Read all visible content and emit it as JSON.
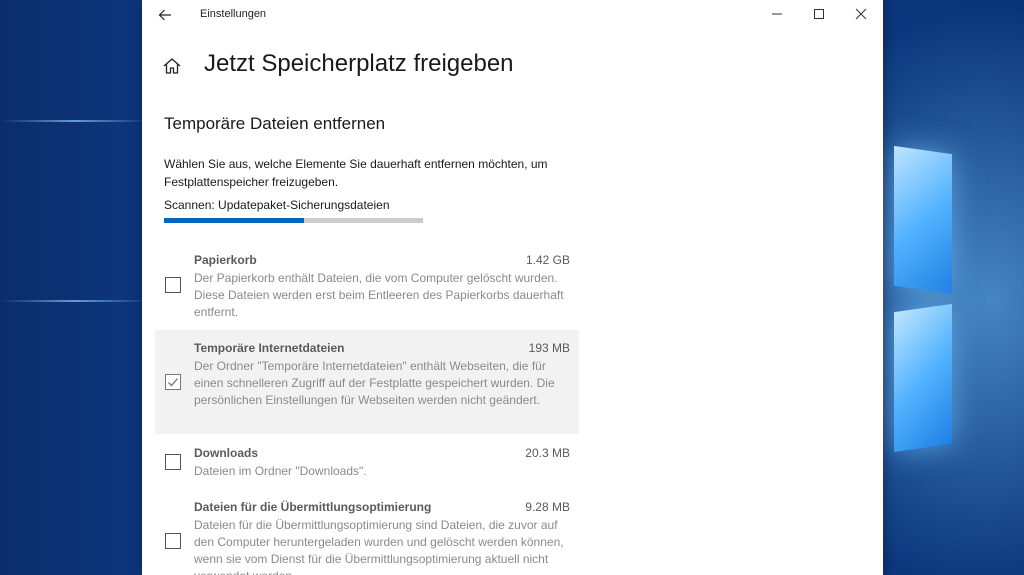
{
  "window": {
    "app_title": "Einstellungen",
    "controls": {
      "minimize": "—",
      "maximize": "☐",
      "close": "✕"
    }
  },
  "page": {
    "title": "Jetzt Speicherplatz freigeben",
    "section_title": "Temporäre Dateien entfernen",
    "description": "Wählen Sie aus, welche Elemente Sie dauerhaft entfernen möchten, um Festplattenspeicher freizugeben.",
    "scan_status": "Scannen: Updatepaket-Sicherungsdateien",
    "scan_progress_fraction": 0.54
  },
  "items": [
    {
      "name": "Papierkorb",
      "size": "1.42 GB",
      "description": "Der Papierkorb enthält Dateien, die vom Computer gelöscht wurden. Diese Dateien werden erst beim Entleeren des Papierkorbs dauerhaft entfernt.",
      "checked": false
    },
    {
      "name": "Temporäre Internetdateien",
      "size": "193 MB",
      "description": "Der Ordner \"Temporäre Internetdateien\" enthält Webseiten, die für einen schnelleren Zugriff auf der Festplatte gespeichert wurden. Die persönlichen Einstellungen für Webseiten werden nicht geändert.",
      "checked": true
    },
    {
      "name": "Downloads",
      "size": "20.3 MB",
      "description": "Dateien im Ordner \"Downloads\".",
      "checked": false
    },
    {
      "name": "Dateien für die Übermittlungsoptimierung",
      "size": "9.28 MB",
      "description": "Dateien für die Übermittlungsoptimierung sind Dateien, die zuvor auf den Computer heruntergeladen wurden und gelöscht werden können, wenn sie vom Dienst für die Übermittlungsoptimierung aktuell nicht verwendet werden.",
      "checked": false
    }
  ],
  "colors": {
    "accent": "#0067c0",
    "progress_track": "#cccccc",
    "selected_row": "#f2f2f2"
  }
}
